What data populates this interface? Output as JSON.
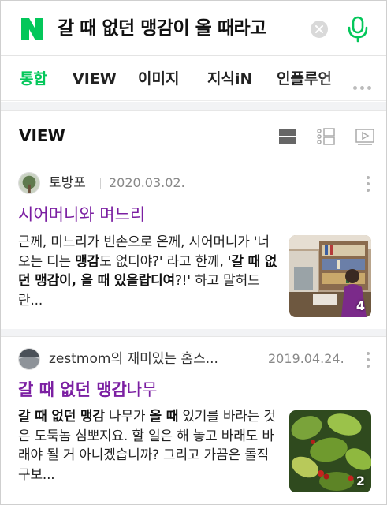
{
  "search": {
    "query": "갈 때 없던 맹감이 올 때라고"
  },
  "tabs": [
    {
      "label": "통합",
      "active": true
    },
    {
      "label": "VIEW",
      "active": false
    },
    {
      "label": "이미지",
      "active": false
    },
    {
      "label": "지식iN",
      "active": false
    },
    {
      "label": "인플루언",
      "active": false
    }
  ],
  "section": {
    "title": "VIEW"
  },
  "posts": [
    {
      "author": "토방포",
      "date": "2020.03.02.",
      "title_parts": [
        {
          "text": "시어머니와 며느리",
          "bold": false
        }
      ],
      "excerpt_parts": [
        {
          "text": "근께, 미느리가 빈손으로 온께, 시어머니가 '너 오는 디는 ",
          "bold": false
        },
        {
          "text": "맹감",
          "bold": true
        },
        {
          "text": "도 없디야?' 라고 한께, '",
          "bold": false
        },
        {
          "text": "갈 때 없던 맹감이, 올 때 있을랍디여",
          "bold": true
        },
        {
          "text": "?!' 하고 말허드란...",
          "bold": false
        }
      ],
      "image_count": "4"
    },
    {
      "author": "zestmom의 재미있는 홈스...",
      "date": "2019.04.24.",
      "title_parts": [
        {
          "text": "갈 때 없던 맹감",
          "bold": true
        },
        {
          "text": "나무",
          "bold": false
        }
      ],
      "excerpt_parts": [
        {
          "text": "갈 때 없던 맹감",
          "bold": true
        },
        {
          "text": " 나무가 ",
          "bold": false
        },
        {
          "text": "올 때",
          "bold": true
        },
        {
          "text": " 있기를 바라는 것은 도둑놈 심뽀지요. 할 일은 해 놓고 바래도 바래야 될 거 아니겠습니까? 그리고 가끔은 돌직구보...",
          "bold": false
        }
      ],
      "image_count": "2"
    }
  ],
  "colors": {
    "brand_green": "#03c75a",
    "title_purple": "#7b1fa2"
  }
}
